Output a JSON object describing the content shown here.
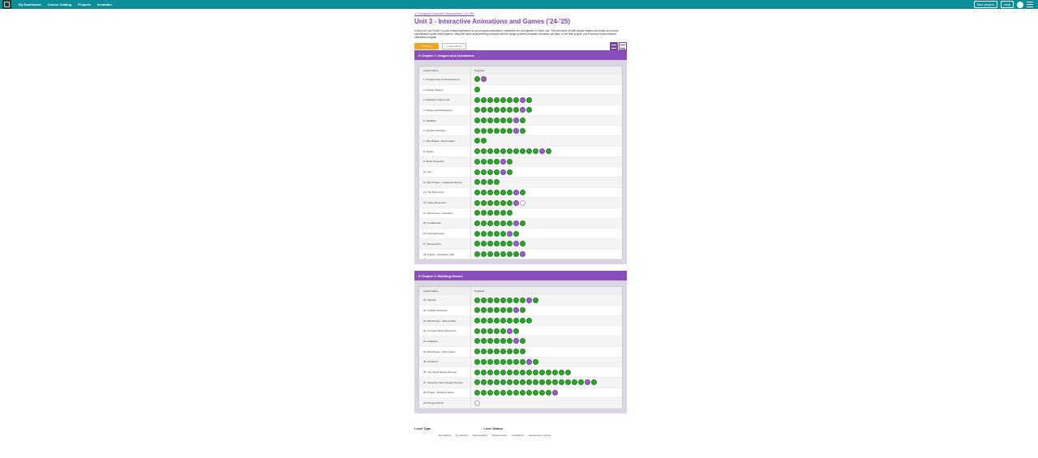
{
  "nav": {
    "items": [
      "My Dashboard",
      "Course Catalog",
      "Projects",
      "Incubator"
    ],
    "new_project": "New project",
    "help": "Help"
  },
  "breadcrumb": "« Computer Science Discoveries ('24-'25)",
  "title": "Unit 3 - Interactive Animations and Games ('24-'25)",
  "description": "In this unit, you'll build on your coding experience as you program animations, interactive art, and games in Game Lab. The unit starts off with simple shapes and builds up to more sophisticated sprite-based games, using the same programming concepts and the design process computer scientists use daily. In the final project, you'll develop a personalized, interactive program.",
  "buttons": {
    "primary": "Continue",
    "secondary": "Lesson Plans"
  },
  "table_header": {
    "lesson": "Lesson Name",
    "progress": "Progress"
  },
  "chapters": [
    {
      "title": "Chapter 1: Images and Animations",
      "lessons": [
        {
          "name": "1. Programming for Entertainment",
          "progress": "gp"
        },
        {
          "name": "2. Plotting Shapes",
          "progress": "g"
        },
        {
          "name": "3. Drawing in Game Lab",
          "progress": "gggggggpg"
        },
        {
          "name": "4. Shapes and Parameters",
          "progress": "gggggggpg"
        },
        {
          "name": "5. Variables",
          "progress": "ggggggpg"
        },
        {
          "name": "6. Random Numbers",
          "progress": "ggggggpg"
        },
        {
          "name": "7. Mini-Project - Robot Faces",
          "progress": "gg"
        },
        {
          "name": "8. Sprites",
          "progress": "ggggggggggpg"
        },
        {
          "name": "9. Sprite Properties",
          "progress": "ggggpg"
        },
        {
          "name": "10. Text",
          "progress": "ggggpg"
        },
        {
          "name": "11. Mini-Project - Captioned Scenes",
          "progress": "gggg"
        },
        {
          "name": "12. The Draw Loop",
          "progress": "ggggggpg"
        },
        {
          "name": "13. Sprite Movement",
          "progress": "ggggggpe"
        },
        {
          "name": "14. Mini-Project - Animation",
          "progress": "gggggg"
        },
        {
          "name": "15. Conditionals",
          "progress": "ggggggpg"
        },
        {
          "name": "16. Keyboard Input",
          "progress": "gggggpg"
        },
        {
          "name": "17. Mouse Input",
          "progress": "ggggggpg"
        },
        {
          "name": "18. Project - Interactive Card",
          "progress": "gggggggp"
        }
      ]
    },
    {
      "title": "Chapter 2: Building Games",
      "lessons": [
        {
          "name": "19. Velocity",
          "progress": "ggggggggpg"
        },
        {
          "name": "20. Collision Detection",
          "progress": "ggggggpg"
        },
        {
          "name": "21. Mini-Project - Side Scroller",
          "progress": "ggggggggg"
        },
        {
          "name": "22. Complex Sprite Movement",
          "progress": "gggggpg"
        },
        {
          "name": "23. Collisions",
          "progress": "ggggggpg"
        },
        {
          "name": "24. Mini-Project - Flyer Game",
          "progress": "gggggggg"
        },
        {
          "name": "25. Functions",
          "progress": "ggggggggpg"
        },
        {
          "name": "26. The Game Design Process",
          "progress": "ggggggggggggggg"
        },
        {
          "name": "27. Using the Game Design Process",
          "progress": "gggggggggggggggggpg"
        },
        {
          "name": "28. Project - Design a Game",
          "progress": "ggggggggggggp"
        },
        {
          "name": "Unit Project Rubric",
          "progress": "e"
        }
      ]
    }
  ],
  "legend": {
    "level_type": "Level Type",
    "level_status": "Level Status",
    "statuses": [
      "Not started",
      "In progress",
      "Keep working",
      "Needs review",
      "Completed",
      "Assessment / survey"
    ]
  },
  "colors": {
    "topbar": "#0b8e9a",
    "purple": "#8a4fbb",
    "green": "#2aa52a",
    "orange": "#f4a31f"
  }
}
